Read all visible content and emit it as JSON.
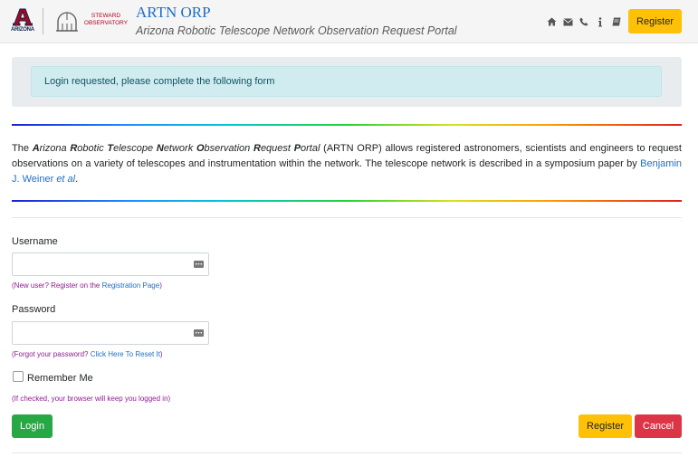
{
  "header": {
    "ua_logo_text": "ARIZONA",
    "steward_logo_line1": "STEWARD",
    "steward_logo_line2": "OBSERVATORY",
    "title": "ARTN ORP",
    "subtitle": "Arizona Robotic Telescope Network Observation Request Portal",
    "icons": [
      "home-icon",
      "envelope-icon",
      "phone-icon",
      "info-icon",
      "book-icon"
    ],
    "register_label": "Register"
  },
  "alert": {
    "message": "Login requested, please complete the following form"
  },
  "intro": {
    "the": "The ",
    "portal_letters": [
      {
        "cap": "A",
        "rest": "rizona "
      },
      {
        "cap": "R",
        "rest": "obotic "
      },
      {
        "cap": "T",
        "rest": "elescope "
      },
      {
        "cap": "N",
        "rest": "etwork "
      },
      {
        "cap": "O",
        "rest": "bservation "
      },
      {
        "cap": "R",
        "rest": "equest "
      },
      {
        "cap": "P",
        "rest": "ortal"
      }
    ],
    "body": " (ARTN ORP) allows registered astronomers, scientists and engineers to request observations on a variety of telescopes and instrumentation within the network. The telescope network is described in a symposium paper by ",
    "link_name": "Benjamin J. Weiner ",
    "link_etal": "et al",
    "end": "."
  },
  "form": {
    "username_label": "Username",
    "username_value": "",
    "username_help_prefix": "(New user? Register on the ",
    "username_help_link": "Registration Page",
    "username_help_suffix": ")",
    "password_label": "Password",
    "password_value": "",
    "password_help_prefix": "(Forgot your password? ",
    "password_help_link": "Click Here To Reset It",
    "password_help_suffix": ")",
    "remember_label": "Remember Me",
    "remember_checked": false,
    "remember_help": "(If checked, your browser will keep you logged in)",
    "login_label": "Login",
    "register_label": "Register",
    "cancel_label": "Cancel"
  },
  "colors": {
    "title_blue": "#1e6fc6",
    "warning": "#ffc107",
    "danger": "#dc3545",
    "success": "#28a745",
    "help_purple": "#8e1d8e",
    "alert_bg": "#d1ecf1"
  }
}
